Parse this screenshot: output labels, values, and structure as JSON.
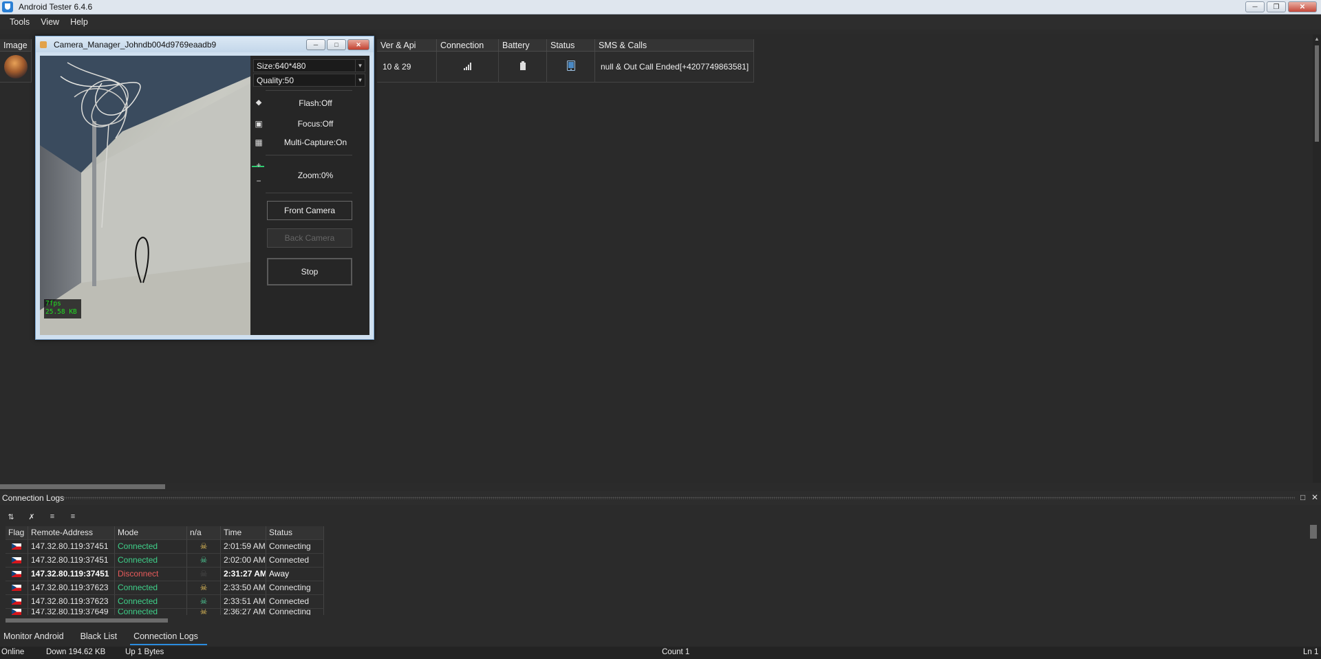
{
  "app": {
    "title": "Android Tester 6.4.6"
  },
  "menu": [
    "Tools",
    "View",
    "Help"
  ],
  "grid": {
    "headers": {
      "image": "Image",
      "ver_api": "Ver & Api",
      "connection": "Connection",
      "battery": "Battery",
      "status": "Status",
      "sms_calls": "SMS & Calls"
    },
    "row": {
      "ver_api": "10 & 29",
      "sms_calls": "null & Out Call Ended[+4207749863581]"
    }
  },
  "camera_dialog": {
    "title": "Camera_Manager_Johndb004d9769eaadb9",
    "size_select": "Size:640*480",
    "quality_select": "Quality:50",
    "flash": "Flash:Off",
    "focus": "Focus:Off",
    "multi_capture": "Multi-Capture:On",
    "zoom_plus": "+",
    "zoom_minus": "−",
    "zoom": "Zoom:0%",
    "front_camera": "Front Camera",
    "back_camera": "Back Camera",
    "stop": "Stop",
    "fps": "7fps",
    "size_kb": "25.58 KB"
  },
  "logs": {
    "title": "Connection Logs",
    "columns": [
      "Flag",
      "Remote-Address",
      "Mode",
      "n/a",
      "Time",
      "Status"
    ],
    "rows": [
      {
        "address": "147.32.80.119:37451",
        "mode": "Connected",
        "time": "2:01:59 AM",
        "status": "Connecting",
        "icon": "skull-yellow"
      },
      {
        "address": "147.32.80.119:37451",
        "mode": "Connected",
        "time": "2:02:00 AM",
        "status": "Connected",
        "icon": "skull-green"
      },
      {
        "address": "147.32.80.119:37451",
        "mode": "Disconnect",
        "time": "2:31:27 AM",
        "status": "Away",
        "icon": "skull-dark"
      },
      {
        "address": "147.32.80.119:37623",
        "mode": "Connected",
        "time": "2:33:50 AM",
        "status": "Connecting",
        "icon": "skull-yellow"
      },
      {
        "address": "147.32.80.119:37623",
        "mode": "Connected",
        "time": "2:33:51 AM",
        "status": "Connected",
        "icon": "skull-green"
      },
      {
        "address": "147.32.80.119:37649",
        "mode": "Connected",
        "time": "2:36:27 AM",
        "status": "Connecting",
        "icon": "skull-yellow"
      }
    ]
  },
  "tabs": [
    "Monitor Android",
    "Black List",
    "Connection Logs"
  ],
  "statusbar": {
    "online": "Online",
    "down": "Down 194.62 KB",
    "up": "Up 1 Bytes",
    "count": "Count 1",
    "line": "Ln 1"
  },
  "colors": {
    "connected": "#3fd18a",
    "disconnect": "#e85b5b",
    "accent": "#2b8de0"
  }
}
